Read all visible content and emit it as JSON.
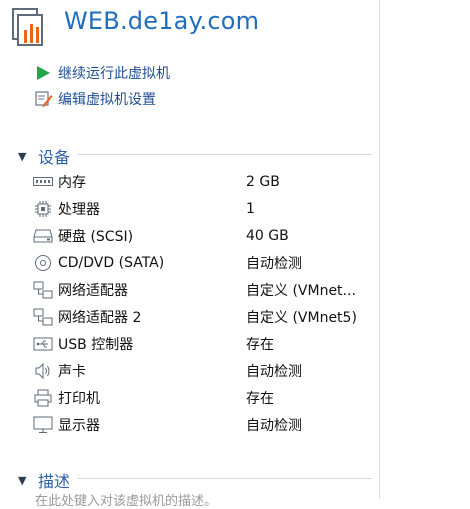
{
  "vm": {
    "title": "WEB.de1ay.com"
  },
  "actions": [
    {
      "label": "继续运行此虚拟机",
      "icon": "play-icon"
    },
    {
      "label": "编辑虚拟机设置",
      "icon": "edit-settings-icon"
    }
  ],
  "sections": {
    "devices": "设备",
    "description": "描述"
  },
  "devices": [
    {
      "name": "内存",
      "value": "2 GB",
      "icon": "memory-icon"
    },
    {
      "name": "处理器",
      "value": "1",
      "icon": "processor-icon"
    },
    {
      "name": "硬盘 (SCSI)",
      "value": "40 GB",
      "icon": "hard-disk-icon"
    },
    {
      "name": "CD/DVD (SATA)",
      "value": "自动检测",
      "icon": "cd-dvd-icon"
    },
    {
      "name": "网络适配器",
      "value": "自定义 (VMnet...",
      "icon": "network-adapter-icon"
    },
    {
      "name": "网络适配器 2",
      "value": "自定义 (VMnet5)",
      "icon": "network-adapter-icon"
    },
    {
      "name": "USB 控制器",
      "value": "存在",
      "icon": "usb-icon"
    },
    {
      "name": "声卡",
      "value": "自动检测",
      "icon": "sound-card-icon"
    },
    {
      "name": "打印机",
      "value": "存在",
      "icon": "printer-icon"
    },
    {
      "name": "显示器",
      "value": "自动检测",
      "icon": "display-icon"
    }
  ],
  "description_placeholder": "在此处键入对该虚拟机的描述。",
  "colors": {
    "title": "#1f6dbd",
    "accent_orange": "#e8641b",
    "play_green": "#22a64a",
    "section_text": "#2f5fa6"
  }
}
